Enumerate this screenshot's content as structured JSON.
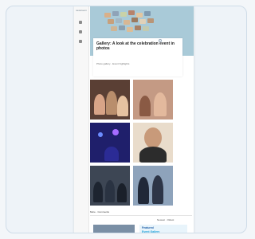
{
  "site": {
    "brand": "newsroom"
  },
  "article": {
    "headline": "Gallery: A look at the celebration event in photos",
    "meta": "Photo gallery · Event highlights"
  },
  "gallery": {
    "photos": [
      {
        "alt": "crowd-photo"
      },
      {
        "alt": "group-photo"
      },
      {
        "alt": "stage-lights-photo"
      },
      {
        "alt": "speaker-portrait-photo"
      },
      {
        "alt": "panel-photo"
      },
      {
        "alt": "audience-photo"
      }
    ]
  },
  "comments": {
    "section_label": "More · Comments",
    "sort_label": "Newest · Oldest"
  },
  "banner": {
    "line1": "Featured",
    "line2": "Event Gallery"
  },
  "colors": {
    "hero_bg": "#a9cad8",
    "accent": "#1f5fa8"
  }
}
